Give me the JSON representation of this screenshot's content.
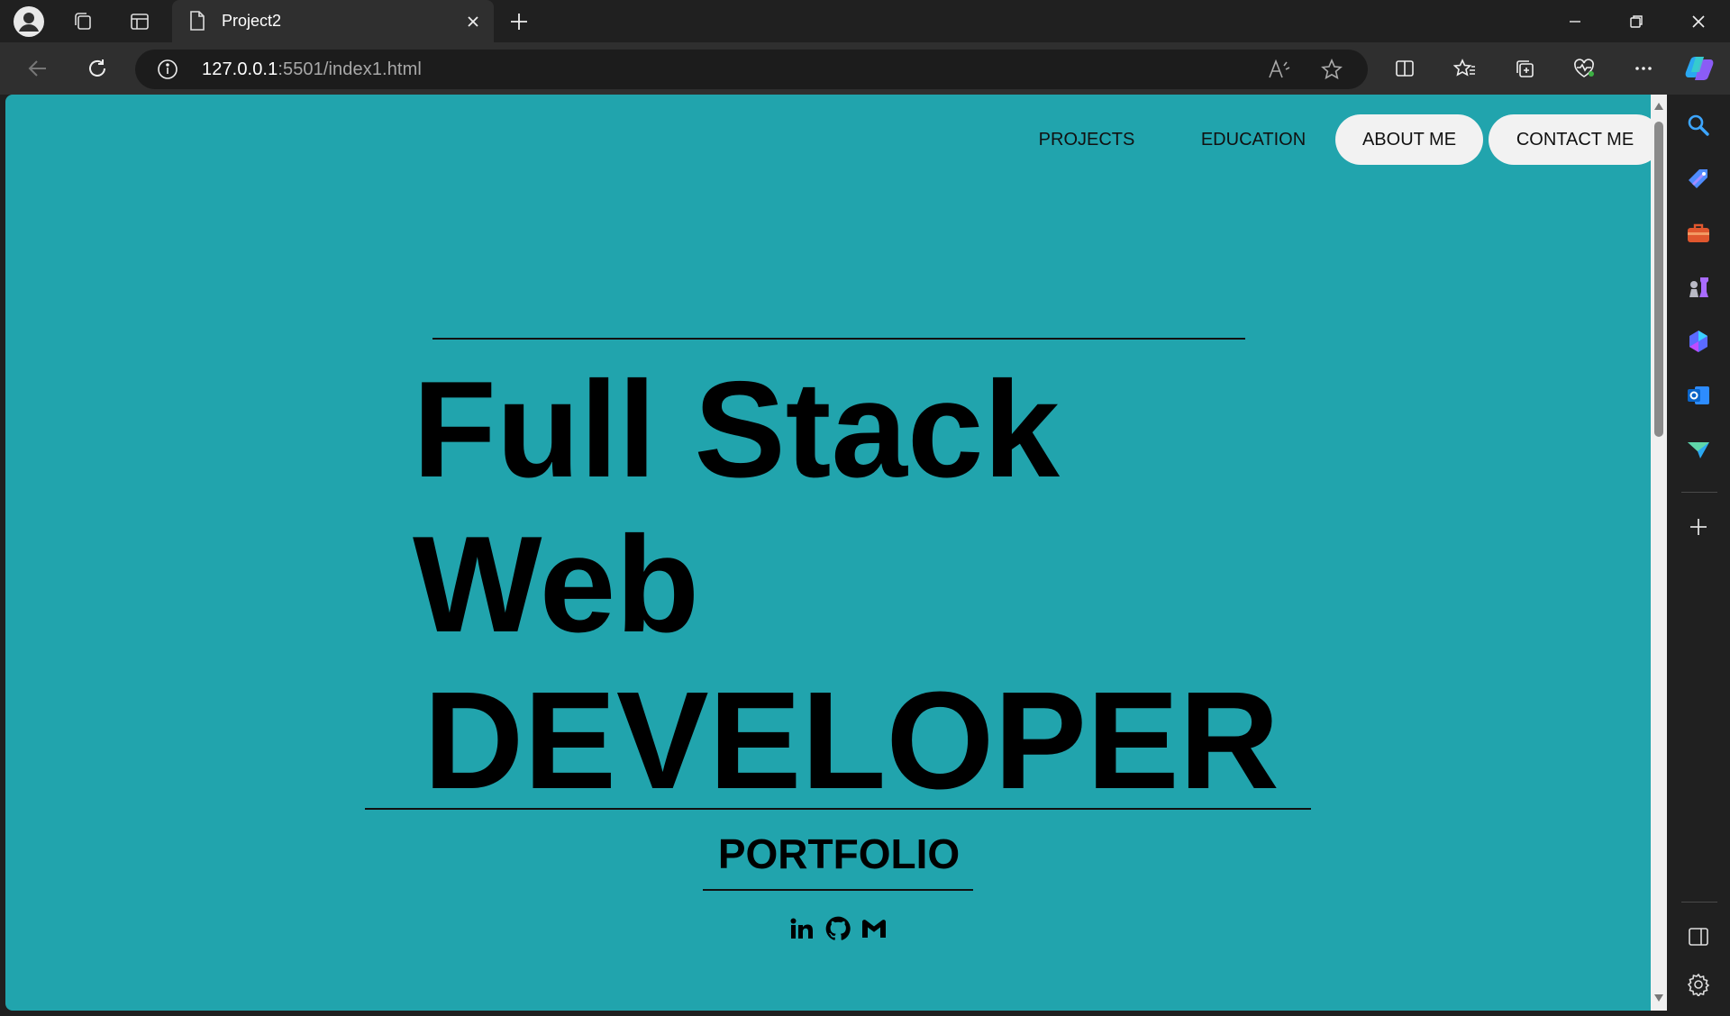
{
  "browser": {
    "tab_title": "Project2",
    "url_host": "127.0.0.1",
    "url_rest": ":5501/index1.html"
  },
  "site": {
    "nav": [
      "PROJECTS",
      "EDUCATION",
      "ABOUT ME",
      "CONTACT ME"
    ],
    "hero_line1": "Full Stack",
    "hero_line2": "Web",
    "hero_line3": "DEVELOPER",
    "subtitle": "PORTFOLIO",
    "social_icons": [
      "linkedin-icon",
      "github-icon",
      "gmail-icon"
    ]
  },
  "colors": {
    "page_bg": "#21a4ad",
    "pill_bg": "#f2f2f2",
    "text": "#000000"
  }
}
